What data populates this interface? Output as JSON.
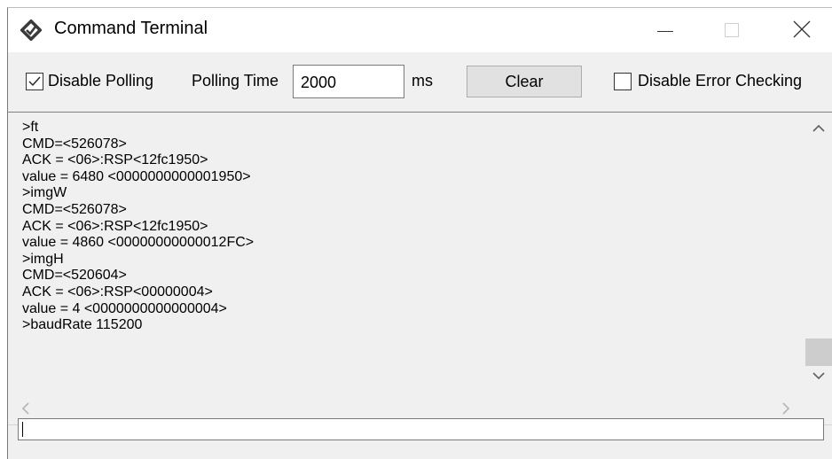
{
  "window": {
    "title": "Command Terminal",
    "app_icon": "terminal-app-icon",
    "controls": [
      "minimize-icon",
      "maximize-icon",
      "close-icon"
    ]
  },
  "toolbar": {
    "disable_polling": {
      "label": "Disable Polling",
      "checked": true
    },
    "polling_time": {
      "label": "Polling Time",
      "value": "2000",
      "unit": "ms"
    },
    "clear_label": "Clear",
    "disable_error_checking": {
      "label": "Disable Error Checking",
      "checked": false
    }
  },
  "log": [
    ">ft",
    "CMD=<526078>",
    "ACK = <06>:RSP<12fc1950>",
    "value = 6480 <0000000000001950>",
    ">imgW",
    "CMD=<526078>",
    "ACK = <06>:RSP<12fc1950>",
    "value = 4860 <00000000000012FC>",
    ">imgH",
    "CMD=<520604>",
    "ACK = <06>:RSP<00000004>",
    "value = 4 <0000000000000004>",
    ">baudRate 115200"
  ],
  "command_input": {
    "value": ""
  },
  "colors": {
    "window_bg": "#f0f0f0",
    "titlebar_bg": "#ffffff",
    "button_bg": "#e1e1e1"
  }
}
